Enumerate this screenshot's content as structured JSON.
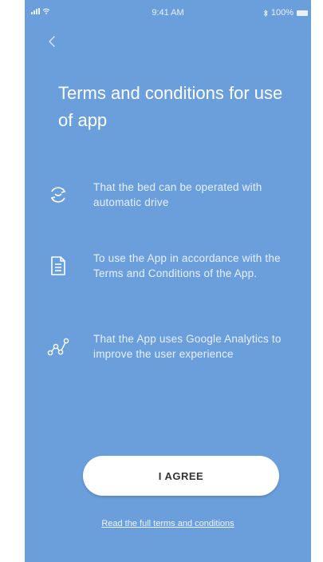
{
  "status_bar": {
    "time": "9:41 AM",
    "battery": "100%",
    "bluetooth_icon": "bluetooth-icon",
    "signal_icon": "signal-icon",
    "wifi_icon": "wifi-icon"
  },
  "nav": {
    "back_icon": "chevron-left-icon"
  },
  "title": "Terms and conditions for use of app",
  "items": [
    {
      "icon": "sync-icon",
      "text": "That the bed can be operated with automatic drive"
    },
    {
      "icon": "document-icon",
      "text": "To use the App in accordance with the Terms and Conditions of the App."
    },
    {
      "icon": "analytics-icon",
      "text": "That the App uses Google Analytics to improve the user experience"
    }
  ],
  "agree_label": "I AGREE",
  "full_terms_link": "Read the full terms and conditions",
  "colors": {
    "background": "#6b9fdc",
    "button": "#ffffff",
    "text": "#ffffff"
  }
}
